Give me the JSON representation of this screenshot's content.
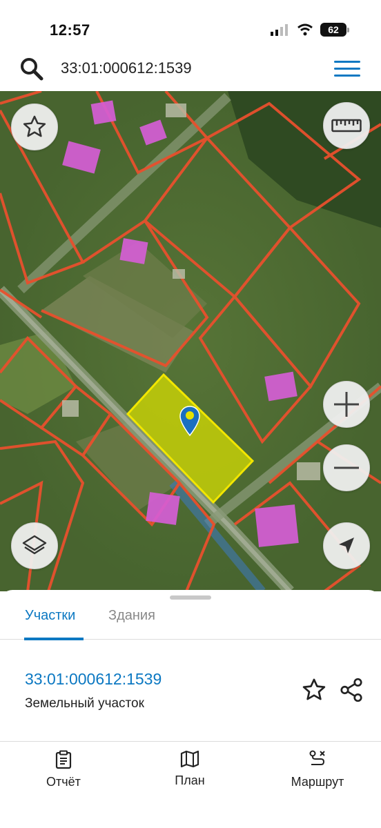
{
  "status_bar": {
    "time": "12:57",
    "battery": "62"
  },
  "search": {
    "query": "33:01:000612:1539"
  },
  "map": {
    "buttons": [
      "favorite-star",
      "ruler",
      "zoom-in",
      "zoom-out",
      "layers",
      "locate"
    ]
  },
  "tabs": {
    "parcels": "Участки",
    "buildings": "Здания"
  },
  "result": {
    "cadastral_number": "33:01:000612:1539",
    "type": "Земельный участок"
  },
  "bottom_nav": {
    "report": "Отчёт",
    "plan": "План",
    "route": "Маршрут"
  },
  "colors": {
    "accent": "#0b78c2",
    "parcel_border": "#e8502d",
    "selected_fill": "#d9e000",
    "building": "#d65ed6"
  }
}
